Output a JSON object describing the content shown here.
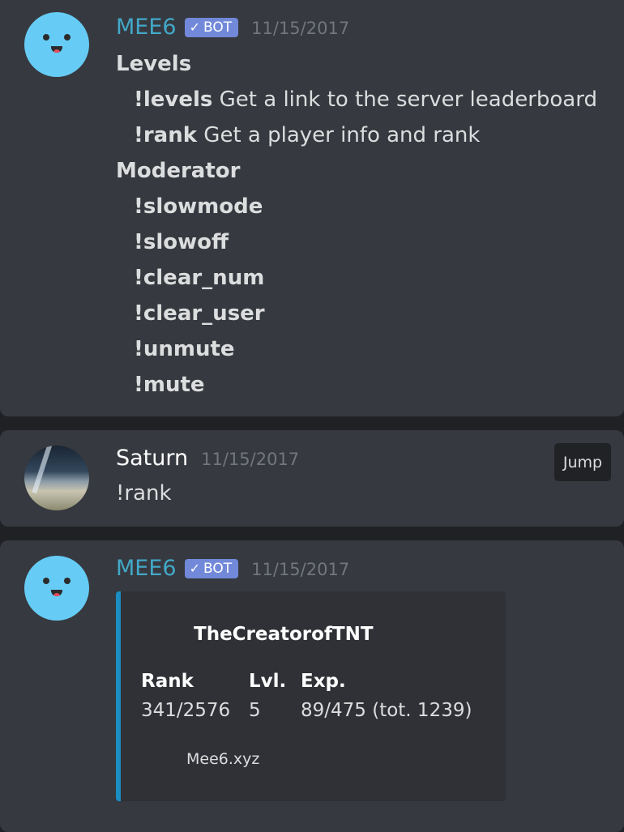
{
  "messages": [
    {
      "author": "MEE6",
      "bot_tag": "BOT",
      "timestamp": "11/15/2017",
      "sections": [
        {
          "heading": "Levels",
          "commands": [
            {
              "cmd": "!levels",
              "desc": "Get a link to the server leaderboard"
            },
            {
              "cmd": "!rank",
              "desc": "Get a player info and rank"
            }
          ]
        },
        {
          "heading": "Moderator",
          "commands": [
            {
              "cmd": "!slowmode",
              "desc": ""
            },
            {
              "cmd": "!slowoff",
              "desc": ""
            },
            {
              "cmd": "!clear_num",
              "desc": ""
            },
            {
              "cmd": "!clear_user",
              "desc": ""
            },
            {
              "cmd": "!unmute",
              "desc": ""
            },
            {
              "cmd": "!mute",
              "desc": ""
            }
          ]
        }
      ]
    },
    {
      "author": "Saturn",
      "timestamp": "11/15/2017",
      "text": "!rank",
      "jump_label": "Jump"
    },
    {
      "author": "MEE6",
      "bot_tag": "BOT",
      "timestamp": "11/15/2017",
      "embed": {
        "title": "TheCreatorofTNT",
        "fields": [
          {
            "name": "Rank",
            "value": "341/2576"
          },
          {
            "name": "Lvl.",
            "value": "5"
          },
          {
            "name": "Exp.",
            "value": "89/475 (tot. 1239)"
          }
        ],
        "footer": "Mee6.xyz",
        "accent_color": "#1b8ec1"
      }
    }
  ],
  "colors": {
    "background": "#36393f",
    "bot_name": "#42a8c8",
    "bot_tag": "#7289da",
    "mee6_avatar": "#66ccf5"
  },
  "icons": {
    "bot_check": "check-icon",
    "mee6_avatar": "smiley-face-avatar",
    "saturn_avatar": "planet-horizon-avatar"
  }
}
